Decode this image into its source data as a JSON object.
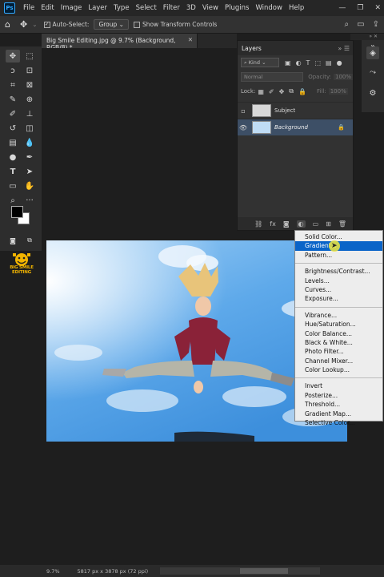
{
  "menubar": {
    "logo": "Ps",
    "items": [
      "File",
      "Edit",
      "Image",
      "Layer",
      "Type",
      "Select",
      "Filter",
      "3D",
      "View",
      "Plugins",
      "Window",
      "Help"
    ]
  },
  "options": {
    "auto_select_label": "Auto-Select:",
    "group_value": "Group",
    "transform_label": "Show Transform Controls"
  },
  "document": {
    "tab_title": "Big Smile Editing.jpg @ 9.7% (Background, RGB/8) *"
  },
  "layers": {
    "title": "Layers",
    "kind_value": "Kind",
    "blend_mode": "Normal",
    "opacity_label": "Opacity:",
    "opacity_value": "100%",
    "lock_label": "Lock:",
    "fill_label": "Fill:",
    "fill_value": "100%",
    "items": [
      {
        "name": "Subject",
        "visible": false,
        "selected": false
      },
      {
        "name": "Background",
        "visible": true,
        "selected": true
      }
    ]
  },
  "brand": {
    "text": "BIG SMILE EDITING"
  },
  "context_menu": {
    "group1": [
      "Solid Color...",
      "Gradient...",
      "Pattern..."
    ],
    "group2": [
      "Brightness/Contrast...",
      "Levels...",
      "Curves...",
      "Exposure..."
    ],
    "group3": [
      "Vibrance...",
      "Hue/Saturation...",
      "Color Balance...",
      "Black & White...",
      "Photo Filter...",
      "Channel Mixer...",
      "Color Lookup..."
    ],
    "group4": [
      "Invert",
      "Posterize...",
      "Threshold...",
      "Gradient Map...",
      "Selective Color..."
    ],
    "hovered": "Gradient..."
  },
  "status": {
    "zoom": "9.7%",
    "dimensions": "5817 px x 3878 px (72 ppi)"
  },
  "colors": {
    "accent": "#0a64c8",
    "panel": "#323232",
    "selected_layer": "#3d4f66",
    "sky": "#6fb6ee"
  }
}
